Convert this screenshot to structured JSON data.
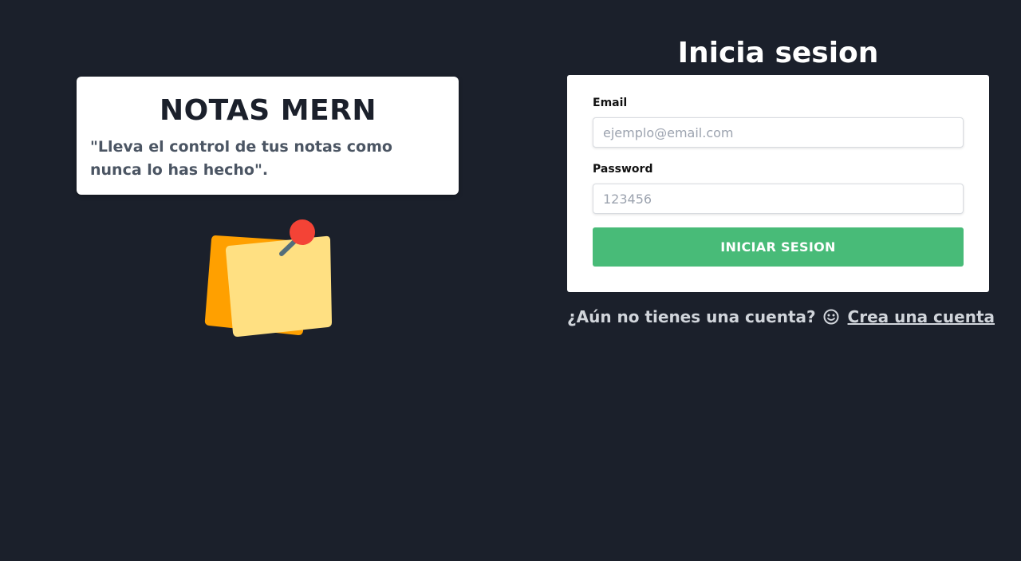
{
  "brand": {
    "title": "NOTAS MERN",
    "tagline": "\"Lleva el control de tus notas como nunca lo has hecho\"."
  },
  "illustration": {
    "icon": "sticky-notes-icon",
    "colors": {
      "back_note": "#ffa000",
      "front_note": "#ffe082",
      "pin_head": "#f44336",
      "pin_needle": "#546e7a"
    }
  },
  "login": {
    "title": "Inicia sesion",
    "email": {
      "label": "Email",
      "placeholder": "ejemplo@email.com",
      "value": ""
    },
    "password": {
      "label": "Password",
      "placeholder": "123456",
      "value": ""
    },
    "submit_label": "INICIAR SESION"
  },
  "signup": {
    "prompt": "¿Aún no tienes una cuenta?",
    "emoji": "smile-emoji-icon",
    "link_label": "Crea una cuenta"
  },
  "colors": {
    "background": "#1b202b",
    "accent": "#48bb78",
    "card": "#ffffff"
  }
}
